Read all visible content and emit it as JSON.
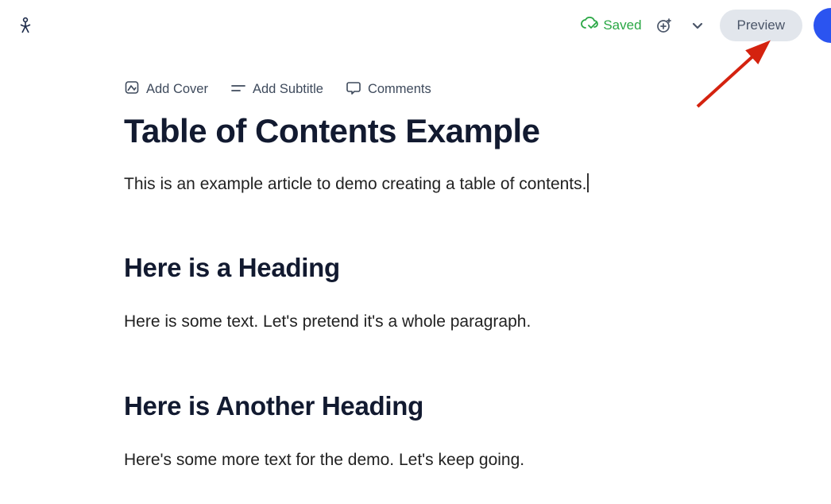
{
  "topbar": {
    "saved_label": "Saved",
    "preview_label": "Preview"
  },
  "meta": {
    "add_cover": "Add Cover",
    "add_subtitle": "Add Subtitle",
    "comments": "Comments"
  },
  "document": {
    "title": "Table of Contents Example",
    "intro": "This is an example article to demo creating a table of contents.",
    "sections": [
      {
        "heading": "Here is a Heading",
        "body": "Here is some text. Let's pretend it's a whole paragraph."
      },
      {
        "heading": "Here is Another Heading",
        "body": "Here's some more text for the demo. Let's keep going."
      }
    ]
  }
}
